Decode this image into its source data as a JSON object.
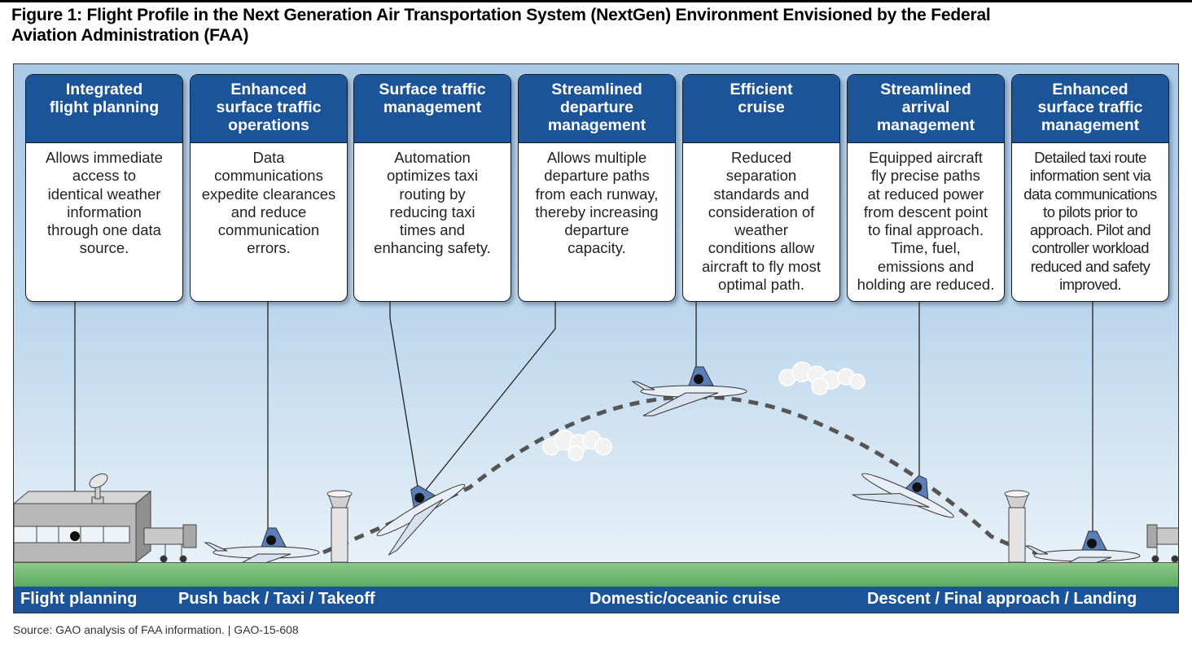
{
  "figure": {
    "title_line1": "Figure 1: Flight Profile in the Next Generation Air Transportation System (NextGen) Environment Envisioned by the Federal",
    "title_line2": "Aviation Administration (FAA)"
  },
  "cards": [
    {
      "title": [
        "Integrated",
        "flight planning"
      ],
      "body": [
        "Allows immediate",
        "access to",
        "identical weather",
        "information",
        "through one data",
        "source."
      ]
    },
    {
      "title": [
        "Enhanced",
        "surface traffic",
        "operations"
      ],
      "body": [
        "Data",
        "communications",
        "expedite clearances",
        "and reduce",
        "communication",
        "errors."
      ]
    },
    {
      "title": [
        "Surface traffic",
        "management"
      ],
      "body": [
        "Automation",
        "optimizes taxi",
        "routing by",
        "reducing taxi",
        "times and",
        "enhancing safety."
      ]
    },
    {
      "title": [
        "Streamlined",
        "departure",
        "management"
      ],
      "body": [
        "Allows multiple",
        "departure paths",
        "from each runway,",
        "thereby increasing",
        "departure",
        "capacity."
      ]
    },
    {
      "title": [
        "Efficient",
        "cruise"
      ],
      "body": [
        "Reduced",
        "separation",
        "standards and",
        "consideration of",
        "weather",
        "conditions allow",
        "aircraft to fly most",
        "optimal path."
      ]
    },
    {
      "title": [
        "Streamlined",
        "arrival",
        "management"
      ],
      "body": [
        "Equipped aircraft",
        "fly precise paths",
        "at reduced power",
        "from descent point",
        "to final approach.",
        "Time, fuel,",
        "emissions and",
        "holding are reduced."
      ]
    },
    {
      "title": [
        "Enhanced",
        "surface traffic",
        "management"
      ],
      "body": [
        "Detailed taxi route",
        "information sent via",
        "data communications",
        "to pilots prior to",
        "approach. Pilot and",
        "controller workload",
        "reduced and safety",
        "improved."
      ]
    }
  ],
  "phases": {
    "flight_planning": "Flight planning",
    "pushback": "Push back / Taxi / Takeoff",
    "cruise": "Domestic/oceanic cruise",
    "descent": "Descent / Final approach / Landing"
  },
  "illustration": {
    "icons": [
      "terminal-building-icon",
      "satellite-dish-icon",
      "jet-bridge-icon",
      "control-tower-icon",
      "airplane-icon",
      "cloud-icon"
    ],
    "colors": {
      "header_blue": "#1c5499",
      "ground_green": "#6ab86c",
      "sky_blue": "#a9c9e6",
      "flight_path": "#555555"
    }
  },
  "source": "Source: GAO analysis of FAA information.  |  GAO-15-608"
}
